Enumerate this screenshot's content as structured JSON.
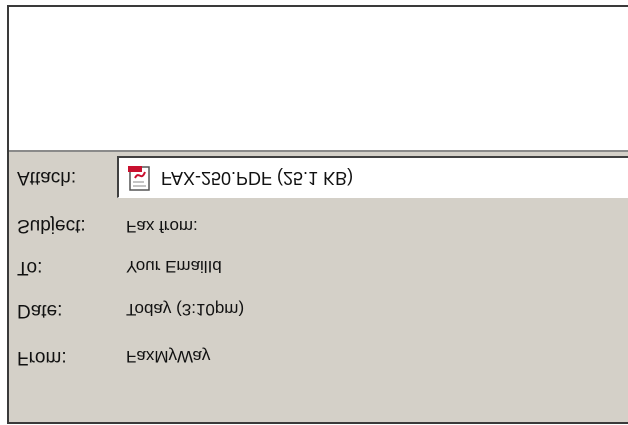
{
  "message": {
    "body_text": ""
  },
  "headers": {
    "attach": {
      "label": "Attach:",
      "icon": "pdf-file-icon",
      "value": "FAX-250.PDF (25.1 KB)"
    },
    "subject": {
      "label": "Subject:",
      "value": "Fax from:"
    },
    "to": {
      "label": "To:",
      "value": "Your EmailId"
    },
    "date": {
      "label": "Date:",
      "value": "Today (3:10pm)"
    },
    "from": {
      "label": "From:",
      "value": "FaxMyWay"
    }
  },
  "colors": {
    "pane": "#d4d0c8",
    "body": "#ffffff",
    "pdf_red": "#c8102e"
  }
}
